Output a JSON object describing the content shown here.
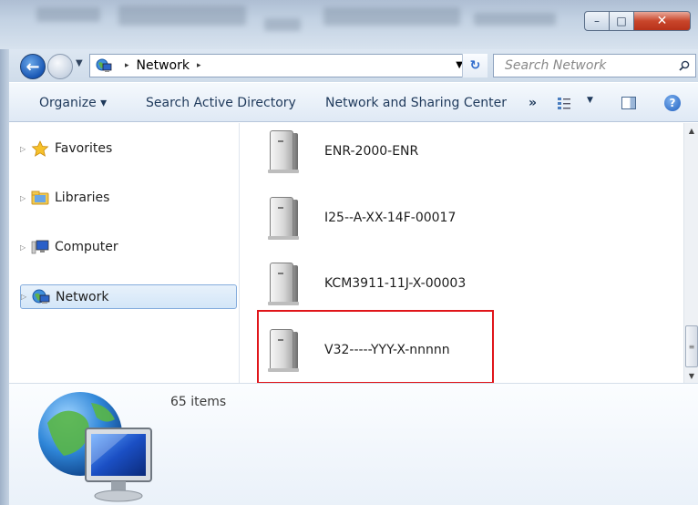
{
  "window": {
    "caption_min": "–",
    "caption_max": "□",
    "caption_close": "✕"
  },
  "address": {
    "crumb": "Network",
    "separator": "▸",
    "search_placeholder": "Search Network"
  },
  "commands": {
    "organize": "Organize ▾",
    "search_ad": "Search Active Directory",
    "sharing": "Network and Sharing Center",
    "more": "»"
  },
  "nav": {
    "items": [
      {
        "label": "Favorites",
        "icon": "star-icon"
      },
      {
        "label": "Libraries",
        "icon": "library-folder-icon"
      },
      {
        "label": "Computer",
        "icon": "computer-icon"
      },
      {
        "label": "Network",
        "icon": "network-icon",
        "selected": true
      }
    ]
  },
  "files": [
    {
      "label": "ENR-2000-ENR",
      "icon": "server-icon"
    },
    {
      "label": "I25--A-XX-14F-00017",
      "icon": "server-icon"
    },
    {
      "label": "KCM3911-11J-X-00003",
      "icon": "server-icon"
    },
    {
      "label": "V32-----YYY-X-nnnnn",
      "icon": "server-icon",
      "highlighted": true
    }
  ],
  "details": {
    "count": "65 items"
  },
  "colors": {
    "highlight": "#e0151a",
    "selection_bg": "#d3e6f8",
    "text": "#1e395b"
  }
}
